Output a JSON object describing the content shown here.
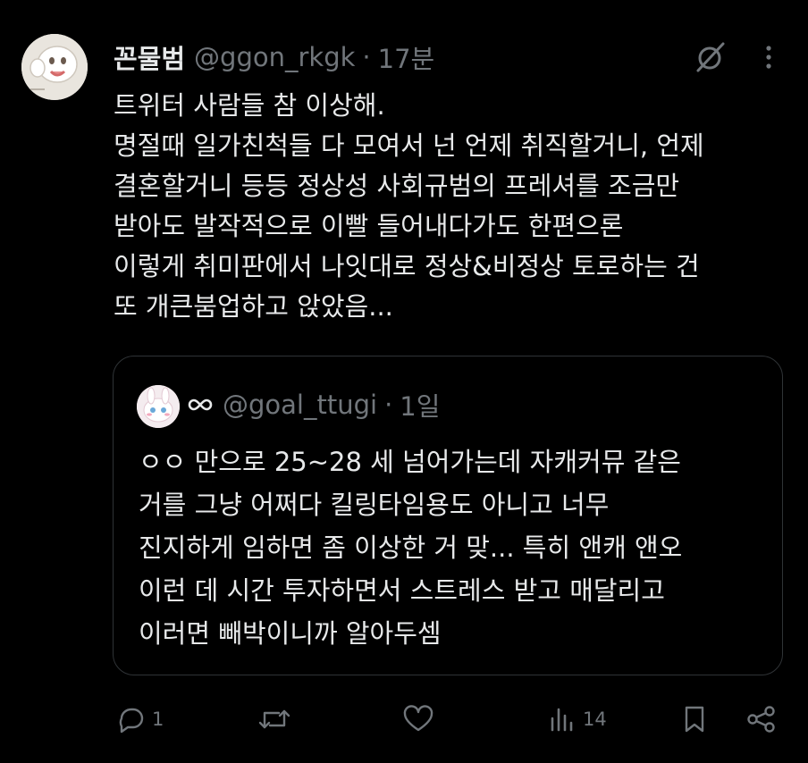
{
  "tweet": {
    "display_name": "꼰물범",
    "handle": "@ggon_rkgk",
    "separator": "·",
    "time": "17분",
    "body_lines": [
      "트위터 사람들 참 이상해.",
      "명절때 일가친척들 다 모여서 넌 언제 취직할거니, 언제",
      "결혼할거니 등등 정상성 사회규범의 프레셔를 조금만",
      "받아도 발작적으로 이빨 들어내다가도 한편으론",
      "이렇게 취미판에서 나잇대로 정상&비정상 토로하는 건",
      "또 개큰붐업하고 앉았음..."
    ]
  },
  "quote": {
    "handle": "@goal_ttugi",
    "separator": "·",
    "time": "1일",
    "body_lines": [
      "ㅇㅇ 만으로 25~28 세 넘어가는데 자캐커뮤 같은",
      "거를 그냥 어쩌다 킬링타임용도 아니고 너무",
      "진지하게 임하면 좀 이상한 거 맞... 특히 앤캐 앤오",
      "이런 데 시간 투자하면서 스트레스 받고 매달리고",
      "이러면 빼박이니까 알아두셈"
    ]
  },
  "actions": {
    "reply_count": "1",
    "retweet_count": "",
    "like_count": "",
    "views_count": "14"
  },
  "icons": {
    "grok": "grok-icon",
    "more": "more-dots-icon",
    "reply": "reply-icon",
    "retweet": "retweet-icon",
    "like": "heart-icon",
    "views": "views-bar-chart-icon",
    "bookmark": "bookmark-icon",
    "share": "share-icon",
    "quote_badge": "infinity-icon"
  },
  "colors": {
    "background": "#000000",
    "text": "#e7e9ea",
    "muted": "#71767b",
    "border": "#2f3336"
  }
}
